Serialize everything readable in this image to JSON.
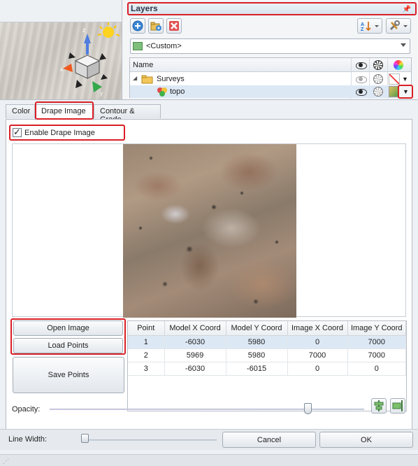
{
  "layers_panel": {
    "title": "Layers",
    "dropdown_value": "<Custom>",
    "column_name": "Name",
    "tree": [
      {
        "label": "Surveys",
        "type": "folder"
      },
      {
        "label": "topo",
        "type": "surface"
      }
    ]
  },
  "tabs": [
    {
      "label": "Color"
    },
    {
      "label": "Drape Image"
    },
    {
      "label": "Contour & Grade"
    }
  ],
  "drape": {
    "enable_label": "Enable Drape Image",
    "enabled": true
  },
  "buttons": {
    "open_image": "Open Image",
    "load_points": "Load Points",
    "save_points": "Save Points",
    "cancel": "Cancel",
    "ok": "OK"
  },
  "points_table": {
    "headers": [
      "Point",
      "Model X Coord",
      "Model Y Coord",
      "Image X Coord",
      "Image Y Coord"
    ],
    "rows": [
      [
        "1",
        "-6030",
        "5980",
        "0",
        "7000"
      ],
      [
        "2",
        "5969",
        "5980",
        "7000",
        "7000"
      ],
      [
        "3",
        "-6030",
        "-6015",
        "0",
        "0"
      ]
    ]
  },
  "opacity": {
    "label": "Opacity:",
    "value_fraction": 0.82
  },
  "line_width": {
    "label": "Line Width:",
    "value_fraction": 0.0
  },
  "colors": {
    "highlight": "#d91f26",
    "selection": "#dde8f5"
  }
}
